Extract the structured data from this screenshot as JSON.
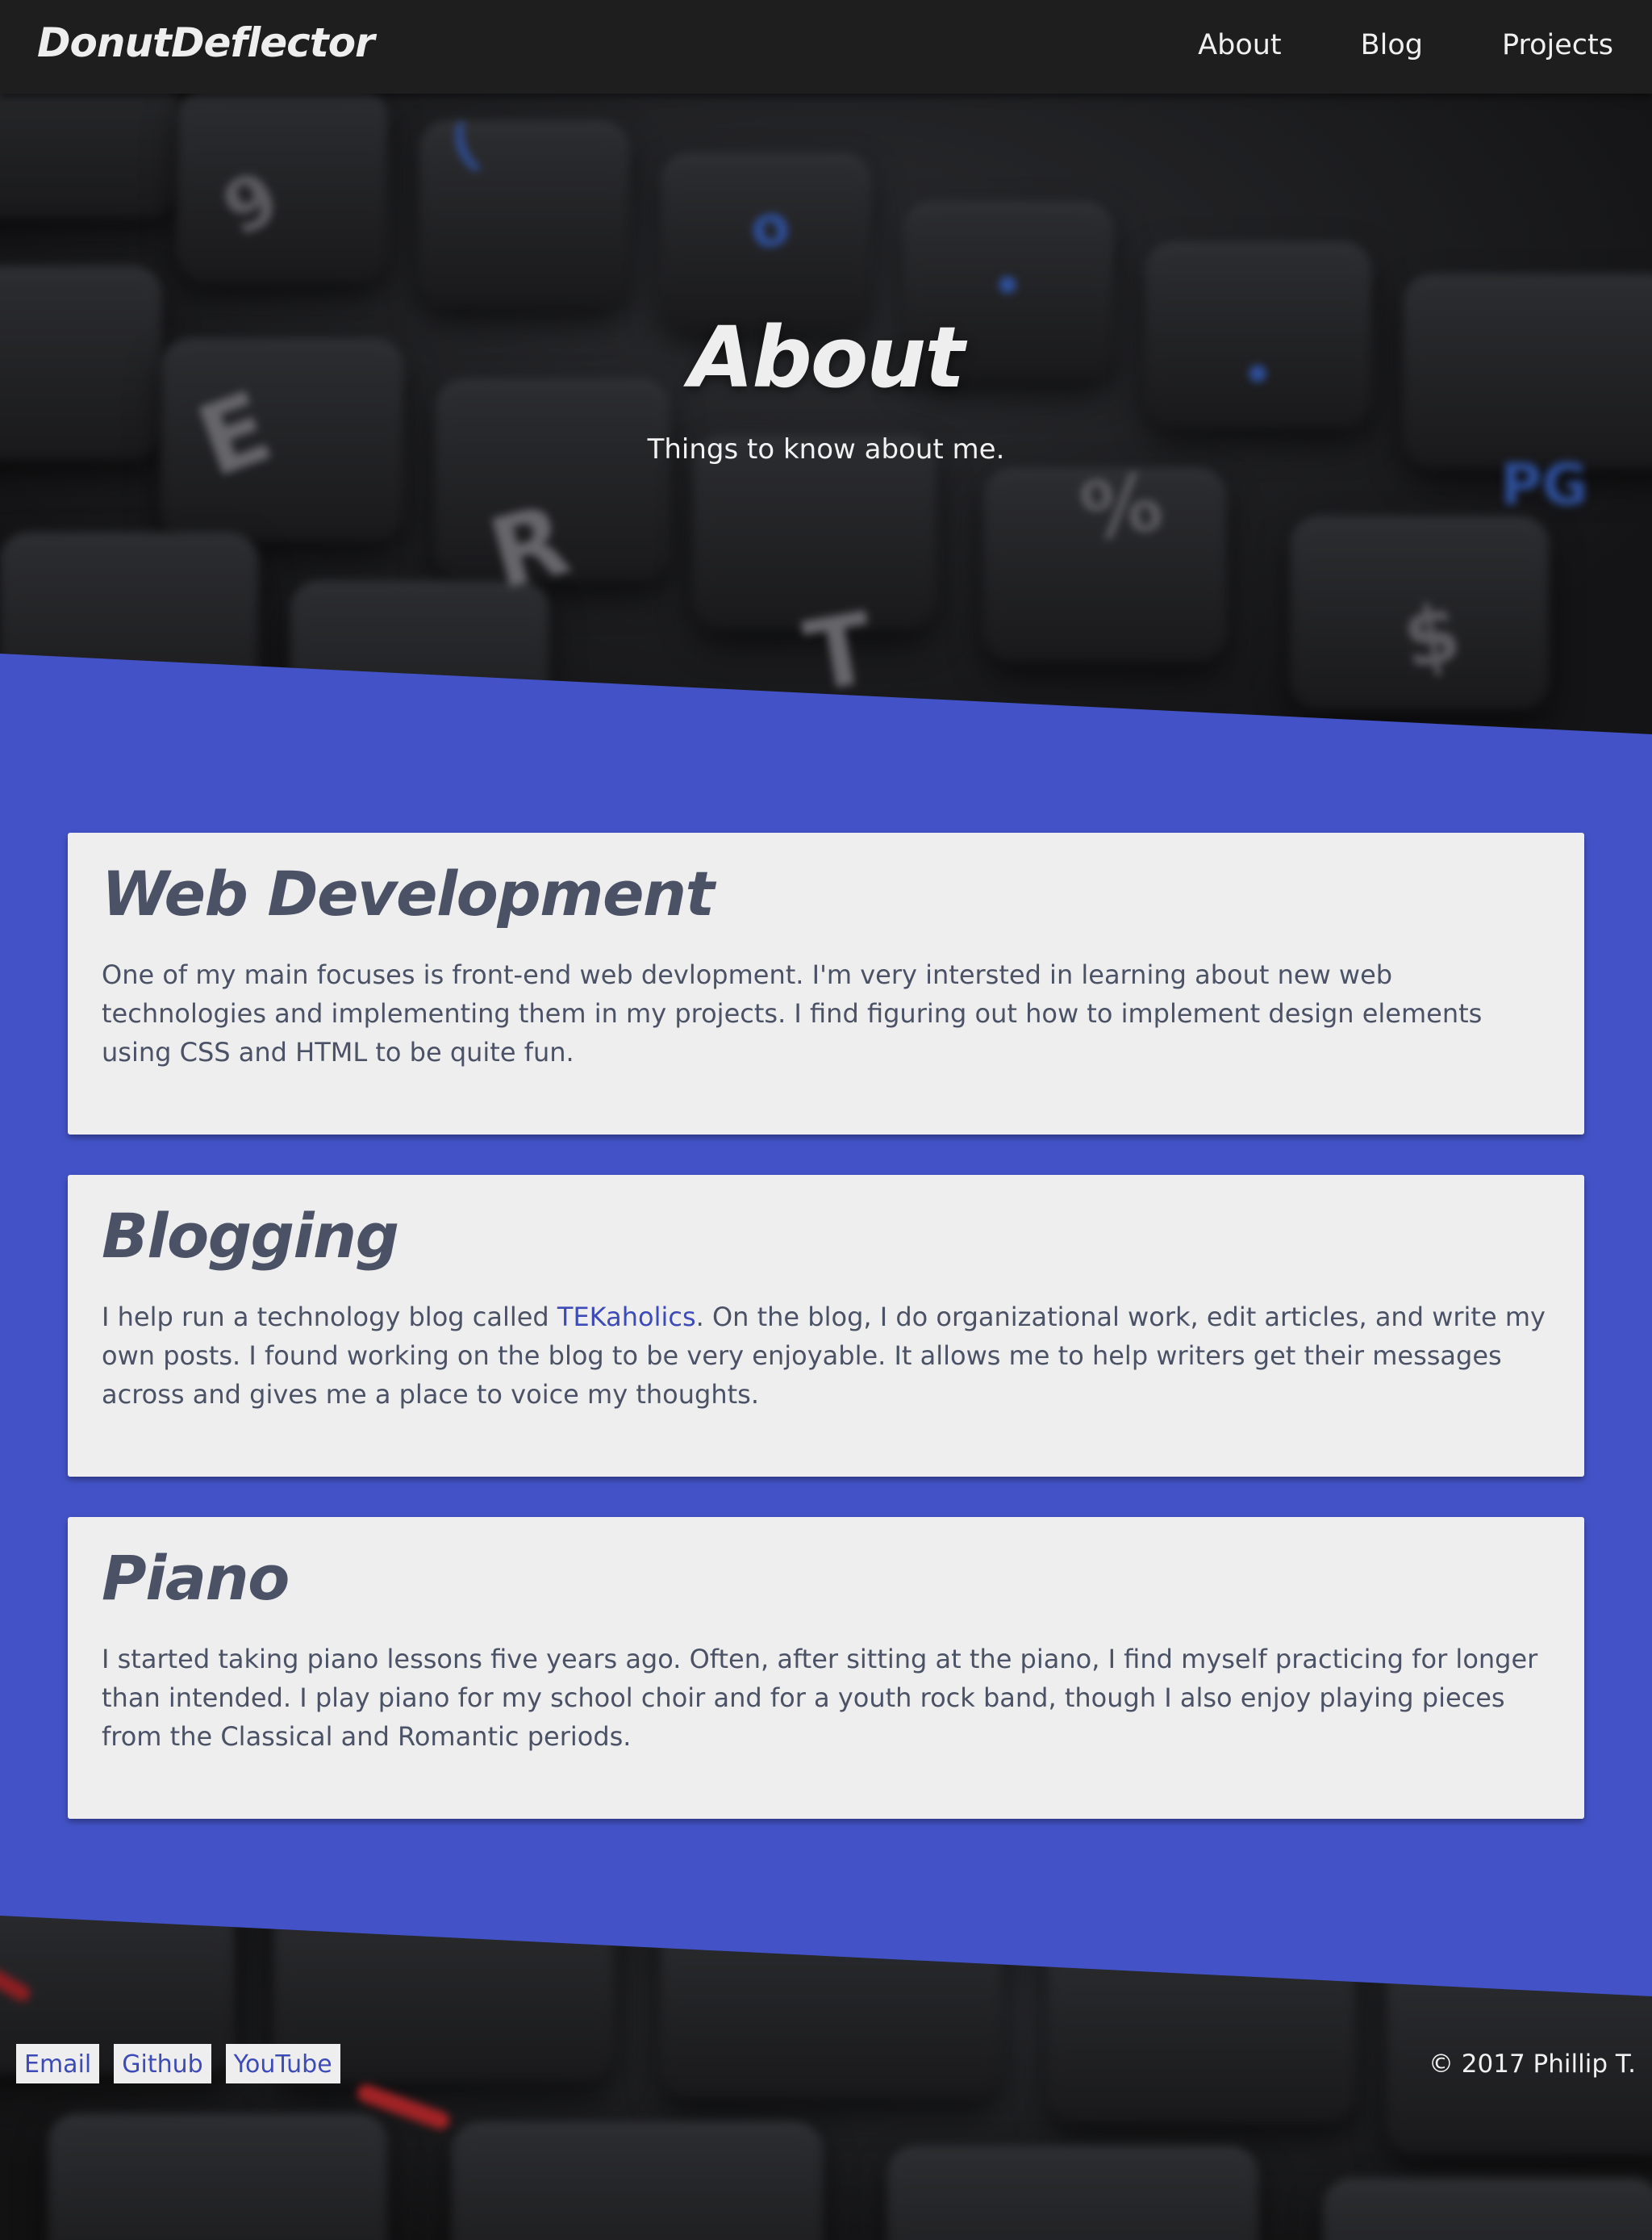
{
  "header": {
    "brand": "DonutDeflector",
    "nav": [
      {
        "label": "About"
      },
      {
        "label": "Blog"
      },
      {
        "label": "Projects"
      }
    ]
  },
  "hero": {
    "title": "About",
    "subtitle": "Things to know about me."
  },
  "sections": [
    {
      "title": "Web Development",
      "body": "One of my main focuses is front-end web devlopment. I'm very intersted in learning about new web technologies and implementing them in my projects. I find figuring out how to implement design elements using CSS and HTML to be quite fun."
    },
    {
      "title": "Blogging",
      "body_before": "I help run a technology blog called ",
      "link": "TEKaholics",
      "body_after": ". On the blog, I do organizational work, edit articles, and write my own posts. I found working on the blog to be very enjoyable. It allows me to help writers get their messages across and gives me a place to voice my thoughts."
    },
    {
      "title": "Piano",
      "body": "I started taking piano lessons five years ago. Often, after sitting at the piano, I find myself practicing for longer than intended. I play piano for my school choir and for a youth rock band, though I also enjoy playing pieces from the Classical and Romantic periods."
    }
  ],
  "footer": {
    "links": [
      {
        "label": "Email"
      },
      {
        "label": "Github"
      },
      {
        "label": "YouTube"
      }
    ],
    "copyright": "© 2017 Phillip T."
  },
  "colors": {
    "accent_blue": "#4353c7",
    "card_bg": "#eeeeee",
    "heading_text": "#4b5266",
    "link": "#3c4bb8",
    "nav_bg": "#1e1e1e"
  }
}
